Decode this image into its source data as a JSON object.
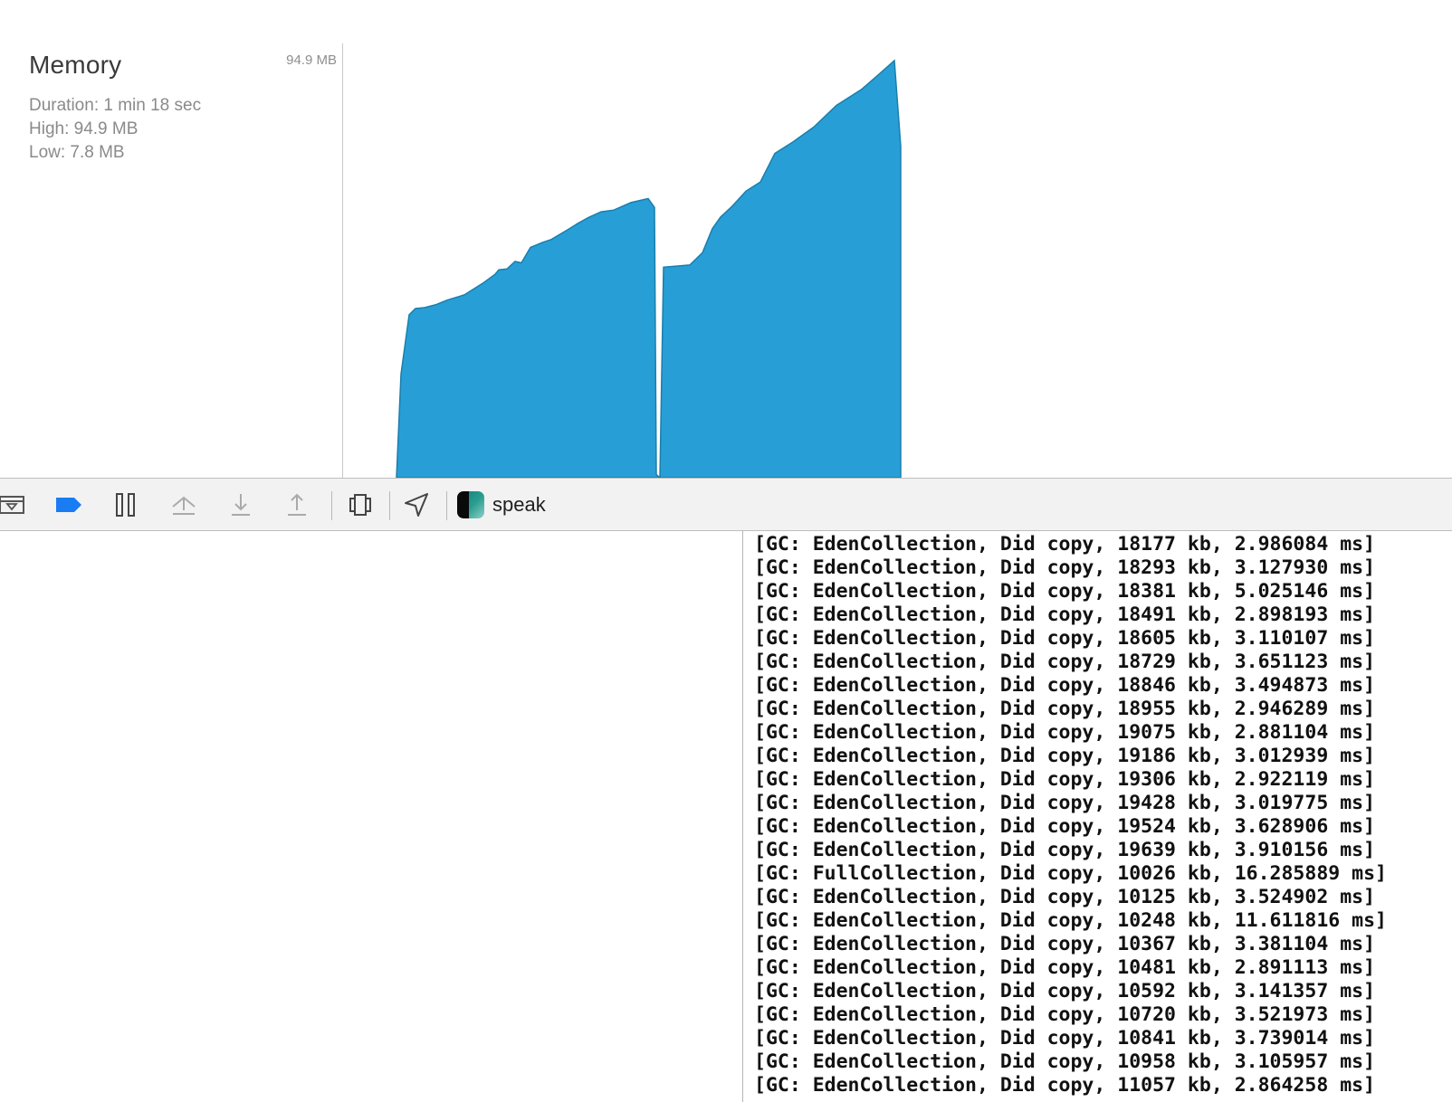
{
  "memory": {
    "title": "Memory",
    "duration": "Duration: 1 min 18 sec",
    "high": "High: 94.9 MB",
    "low": "Low: 7.8 MB",
    "graph_max_label": "94.9 MB"
  },
  "chart_data": {
    "type": "area",
    "title": "Memory",
    "ylabel": "MB",
    "ylim": [
      0,
      94.9
    ],
    "color": "#279fd6",
    "stroke": "#1b7eac",
    "series": [
      {
        "values_mb": [
          0,
          23.6,
          37.1,
          38.5,
          38.7,
          39.4,
          40.4,
          41.6,
          44.2,
          46.3,
          47.3,
          47.5,
          49.2,
          48.9,
          52.4,
          53.5,
          54.2,
          56.4,
          57.7,
          59.2,
          60.5,
          60.9,
          62.6,
          63.5,
          61.5,
          0.7,
          0,
          47.9,
          48.4,
          51.2,
          56.7,
          59.3,
          61.8,
          65.2,
          67.3,
          73.8,
          76.4,
          79.8,
          84.7,
          88.4,
          91.8,
          94.9,
          75.4,
          0
        ]
      }
    ]
  },
  "toolbar": {
    "buttons": [
      {
        "name": "hide-debug-area-button",
        "icon": "panel-toggle-icon"
      },
      {
        "name": "breakpoints-toggle-button",
        "icon": "breakpoint-icon"
      },
      {
        "name": "pause-button",
        "icon": "pause-icon"
      },
      {
        "name": "step-over-button",
        "icon": "step-over-icon"
      },
      {
        "name": "step-into-button",
        "icon": "step-into-icon"
      },
      {
        "name": "step-out-button",
        "icon": "step-out-icon"
      },
      {
        "name": "debug-view-hierarchy-button",
        "icon": "view-hierarchy-icon"
      },
      {
        "name": "simulate-location-button",
        "icon": "location-arrow-icon"
      }
    ],
    "app_name": "speak"
  },
  "console": {
    "lines": [
      "[GC: EdenCollection, Did copy, 18177 kb, 2.986084 ms]",
      "[GC: EdenCollection, Did copy, 18293 kb, 3.127930 ms]",
      "[GC: EdenCollection, Did copy, 18381 kb, 5.025146 ms]",
      "[GC: EdenCollection, Did copy, 18491 kb, 2.898193 ms]",
      "[GC: EdenCollection, Did copy, 18605 kb, 3.110107 ms]",
      "[GC: EdenCollection, Did copy, 18729 kb, 3.651123 ms]",
      "[GC: EdenCollection, Did copy, 18846 kb, 3.494873 ms]",
      "[GC: EdenCollection, Did copy, 18955 kb, 2.946289 ms]",
      "[GC: EdenCollection, Did copy, 19075 kb, 2.881104 ms]",
      "[GC: EdenCollection, Did copy, 19186 kb, 3.012939 ms]",
      "[GC: EdenCollection, Did copy, 19306 kb, 2.922119 ms]",
      "[GC: EdenCollection, Did copy, 19428 kb, 3.019775 ms]",
      "[GC: EdenCollection, Did copy, 19524 kb, 3.628906 ms]",
      "[GC: EdenCollection, Did copy, 19639 kb, 3.910156 ms]",
      "[GC: FullCollection, Did copy, 10026 kb, 16.285889 ms]",
      "[GC: EdenCollection, Did copy, 10125 kb, 3.524902 ms]",
      "[GC: EdenCollection, Did copy, 10248 kb, 11.611816 ms]",
      "[GC: EdenCollection, Did copy, 10367 kb, 3.381104 ms]",
      "[GC: EdenCollection, Did copy, 10481 kb, 2.891113 ms]",
      "[GC: EdenCollection, Did copy, 10592 kb, 3.141357 ms]",
      "[GC: EdenCollection, Did copy, 10720 kb, 3.521973 ms]",
      "[GC: EdenCollection, Did copy, 10841 kb, 3.739014 ms]",
      "[GC: EdenCollection, Did copy, 10958 kb, 3.105957 ms]",
      "[GC: EdenCollection, Did copy, 11057 kb, 2.864258 ms]"
    ]
  }
}
